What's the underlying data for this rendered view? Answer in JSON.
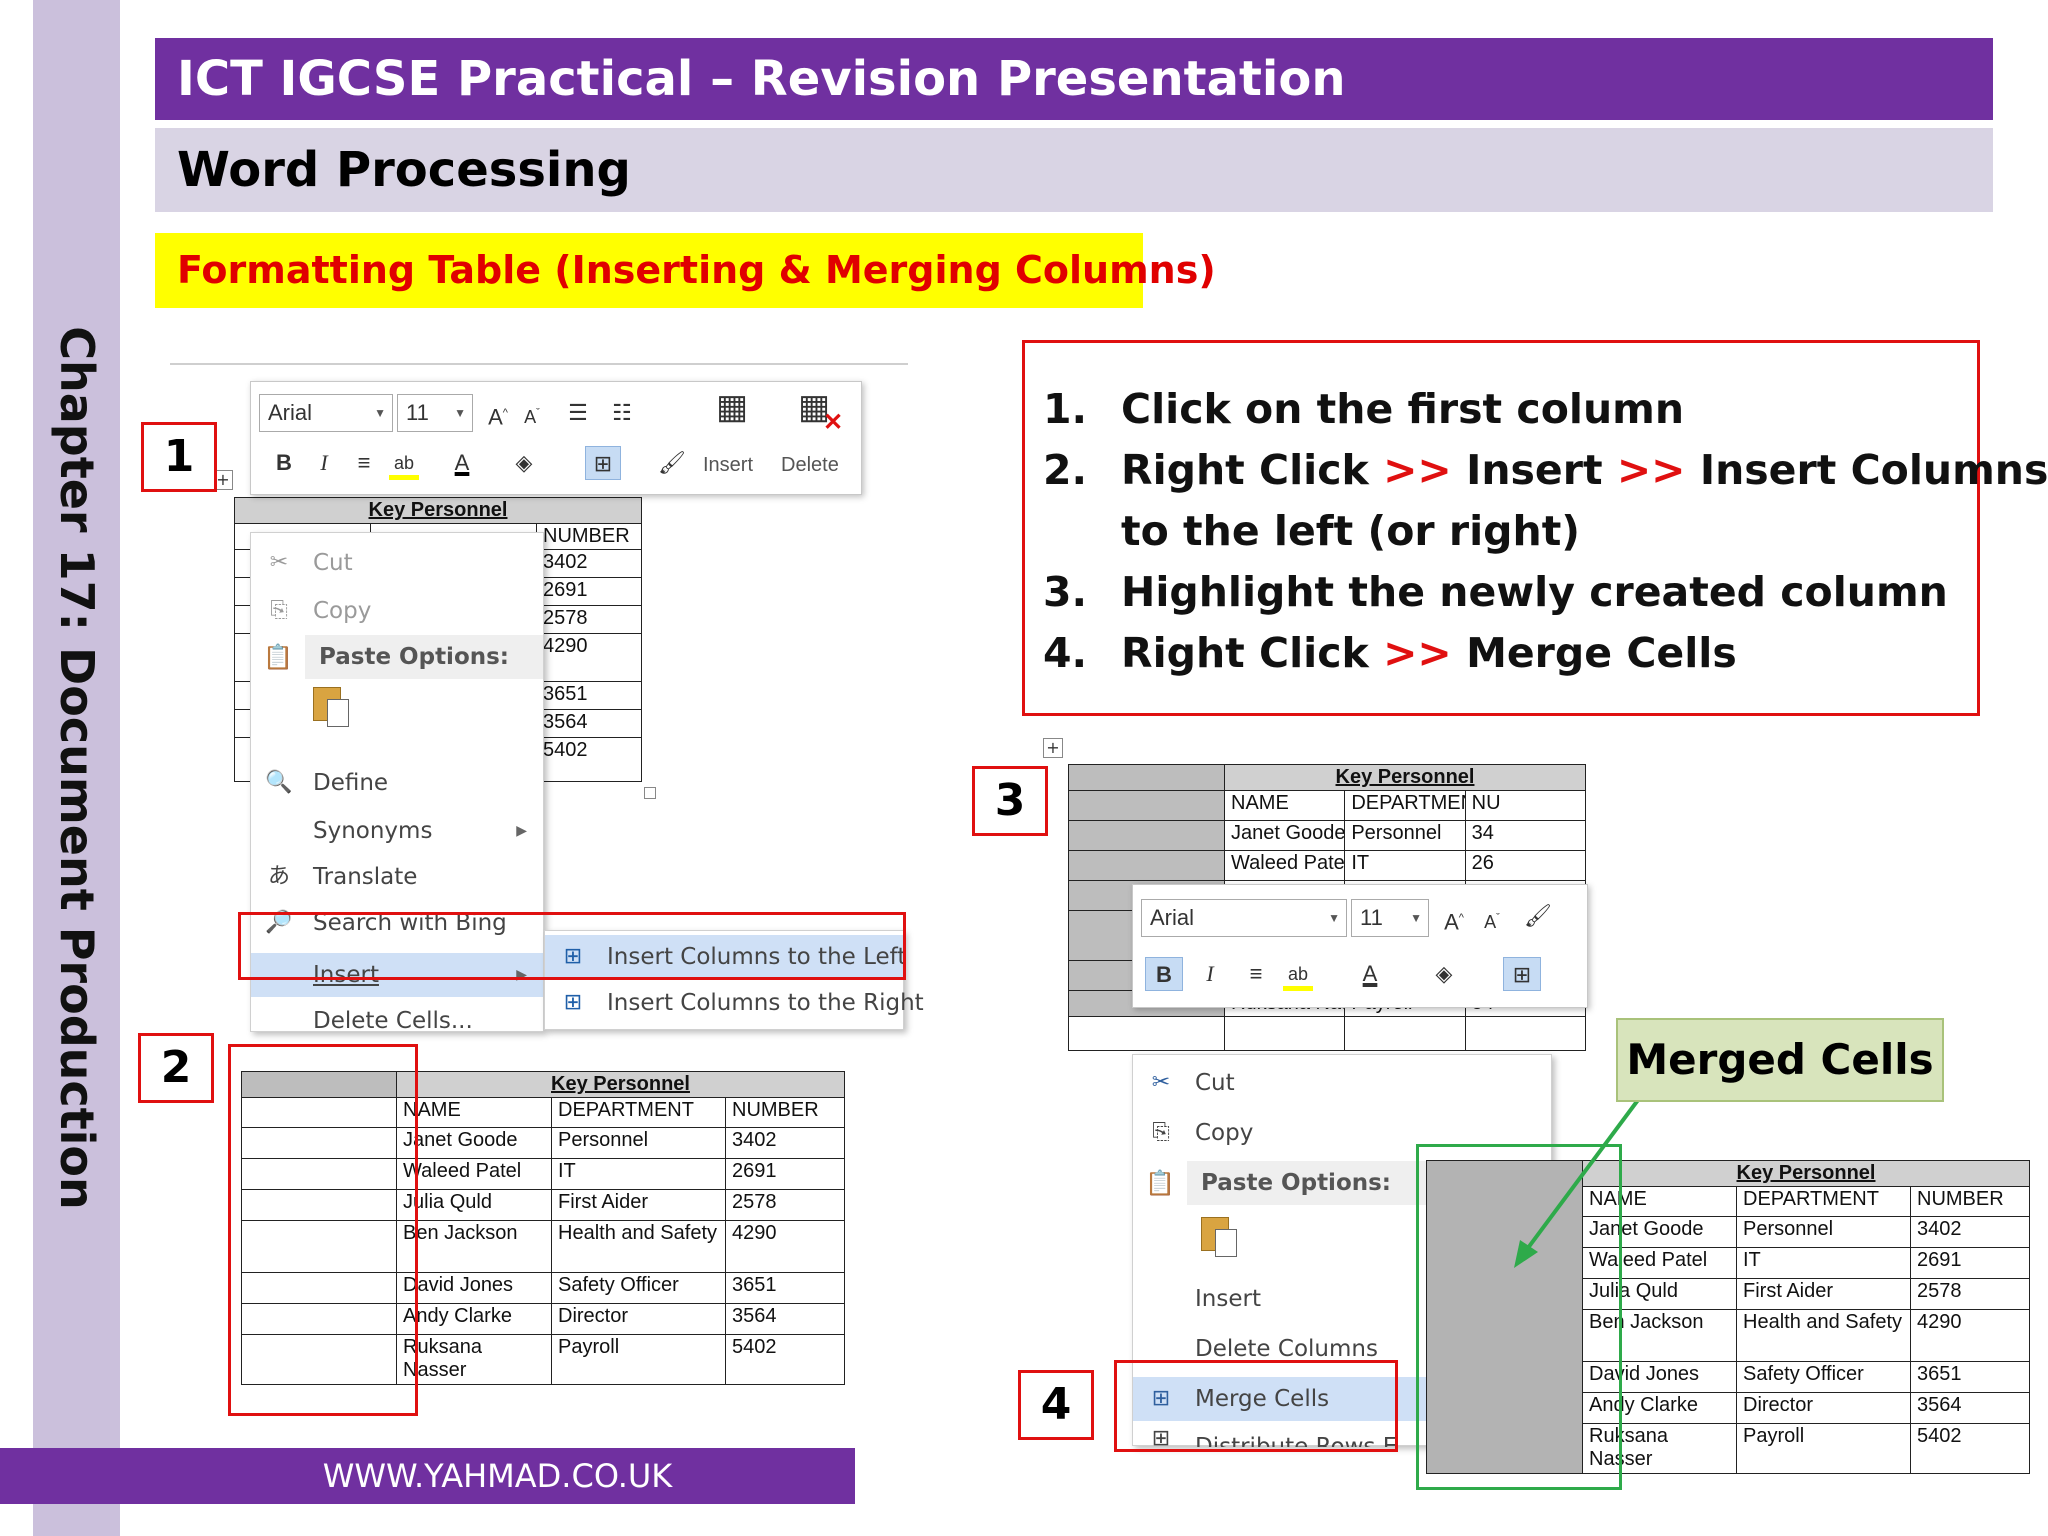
{
  "slide": {
    "chapter": "Chapter 17: Document Production",
    "title": "ICT IGCSE Practical – Revision Presentation",
    "subtitle": "Word Processing",
    "topic": "Formatting Table (Inserting & Merging Columns)",
    "footer": "WWW.YAHMAD.CO.UK"
  },
  "steps": {
    "badge1": "1",
    "badge2": "2",
    "badge3": "3",
    "badge4": "4"
  },
  "instructions": {
    "lines": [
      {
        "num": "1.",
        "parts": [
          "Click on the first column"
        ]
      },
      {
        "num": "2.",
        "parts": [
          "Right Click ",
          ">>",
          " Insert ",
          ">>",
          " Insert Columns"
        ]
      },
      {
        "num": "",
        "parts": [
          "to the left (or right)"
        ]
      },
      {
        "num": "3.",
        "parts": [
          "Highlight the newly created column"
        ]
      },
      {
        "num": "4.",
        "parts": [
          "Right Click ",
          ">>",
          " Merge Cells"
        ]
      }
    ]
  },
  "merged_label": "Merged Cells",
  "table": {
    "caption": "Key Personnel",
    "headers": [
      "NAME",
      "DEPARTMENT",
      "NUMBER"
    ],
    "rows": [
      {
        "name": "Janet Goode",
        "dept": "Personnel",
        "num": "3402"
      },
      {
        "name": "Waleed Patel",
        "dept": "IT",
        "num": "2691"
      },
      {
        "name": "Julia Quld",
        "dept": "First Aider",
        "num": "2578"
      },
      {
        "name": "Ben Jackson",
        "dept": "Health and Safety",
        "num": "4290"
      },
      {
        "name": "David Jones",
        "dept": "Safety Officer",
        "num": "3651"
      },
      {
        "name": "Andy Clarke",
        "dept": "Director",
        "num": "3564"
      },
      {
        "name": "Ruksana Nasser",
        "dept": "Payroll",
        "num": "5402"
      }
    ],
    "s1_numbers": [
      "3402",
      "2691",
      "2578",
      "4290",
      "3651",
      "3564",
      "5402"
    ],
    "s3_partial": [
      "NU",
      "34",
      "26",
      "54"
    ]
  },
  "toolbar1": {
    "font": "Arial",
    "size": "11",
    "insert_label": "Insert",
    "delete_label": "Delete"
  },
  "toolbar3": {
    "font": "Arial",
    "size": "11"
  },
  "menu1": {
    "cut": "Cut",
    "copy": "Copy",
    "paste_options": "Paste Options:",
    "define": "Define",
    "synonyms": "Synonyms",
    "translate": "Translate",
    "search": "Search with Bing",
    "insert": "Insert",
    "delete_cells": "Delete Cells...",
    "sub_left": "Insert Columns to the Left",
    "sub_right": "Insert Columns to the Right"
  },
  "menu4": {
    "cut": "Cut",
    "copy": "Copy",
    "paste_options": "Paste Options:",
    "insert": "Insert",
    "delete_columns": "Delete Columns",
    "merge_cells": "Merge Cells",
    "distribute": "Distribute Rows E"
  },
  "colors": {
    "purple": "#7030a0",
    "lavender": "#d9d4e4",
    "yellow": "#ffff00",
    "red": "#e01010",
    "green": "#2eaa4a",
    "highlight": "#cfe0f6"
  }
}
